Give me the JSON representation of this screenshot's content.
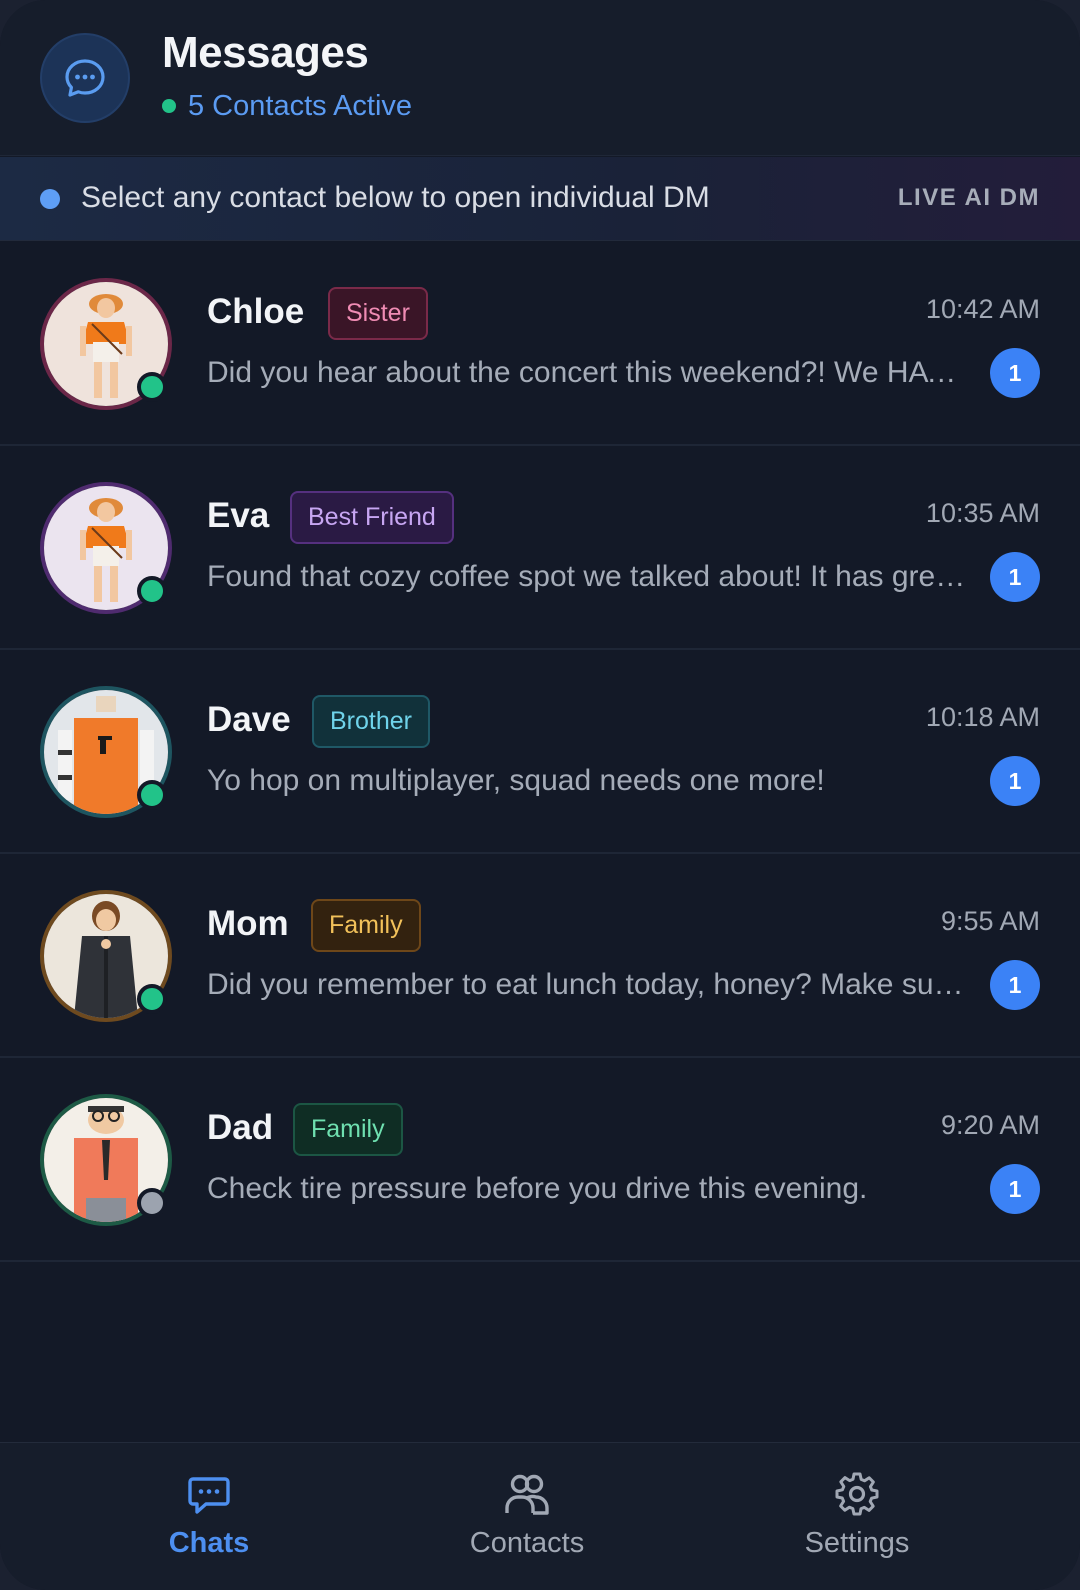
{
  "header": {
    "title": "Messages",
    "subtitle": "5 Contacts Active",
    "icon": "chat-bubble-icon"
  },
  "banner": {
    "text": "Select any contact below to open individual DM",
    "badge": "LIVE AI DM"
  },
  "contacts": [
    {
      "name": "Chloe",
      "tag": "Sister",
      "time": "10:42 AM",
      "preview": "Did you hear about the concert this weekend?! We HAVE to go!",
      "unread": "1",
      "online": true,
      "ring": "#6b2748",
      "tag_bg": "#3a1527",
      "tag_border": "#7a2a49",
      "tag_color": "#f08cb4"
    },
    {
      "name": "Eva",
      "tag": "Best Friend",
      "time": "10:35 AM",
      "preview": "Found that cozy coffee spot we talked about! It has great vibes",
      "unread": "1",
      "online": true,
      "ring": "#4f2b6f",
      "tag_bg": "#2a1a44",
      "tag_border": "#55307f",
      "tag_color": "#c7a6f2"
    },
    {
      "name": "Dave",
      "tag": "Brother",
      "time": "10:18 AM",
      "preview": "Yo hop on multiplayer, squad needs one more!",
      "unread": "1",
      "online": true,
      "ring": "#1e5560",
      "tag_bg": "#11313a",
      "tag_border": "#1f5866",
      "tag_color": "#6fd3ea"
    },
    {
      "name": "Mom",
      "tag": "Family",
      "time": "9:55 AM",
      "preview": "Did you remember to eat lunch today, honey? Make sure you do.",
      "unread": "1",
      "online": true,
      "ring": "#6e4a1f",
      "tag_bg": "#33220f",
      "tag_border": "#6e4719",
      "tag_color": "#f2c15a"
    },
    {
      "name": "Dad",
      "tag": "Family",
      "time": "9:20 AM",
      "preview": "Check tire pressure before you drive this evening.",
      "unread": "1",
      "online": false,
      "ring": "#1d5a45",
      "tag_bg": "#0f2d24",
      "tag_border": "#1c5644",
      "tag_color": "#6fe0b0"
    }
  ],
  "nav": {
    "items": [
      {
        "label": "Chats",
        "icon": "chat-bubble-icon",
        "active": true
      },
      {
        "label": "Contacts",
        "icon": "users-icon",
        "active": false
      },
      {
        "label": "Settings",
        "icon": "gear-icon",
        "active": false
      }
    ]
  },
  "colors": {
    "accent": "#3b82f6",
    "online": "#22c389",
    "offline": "#9ca3af"
  }
}
